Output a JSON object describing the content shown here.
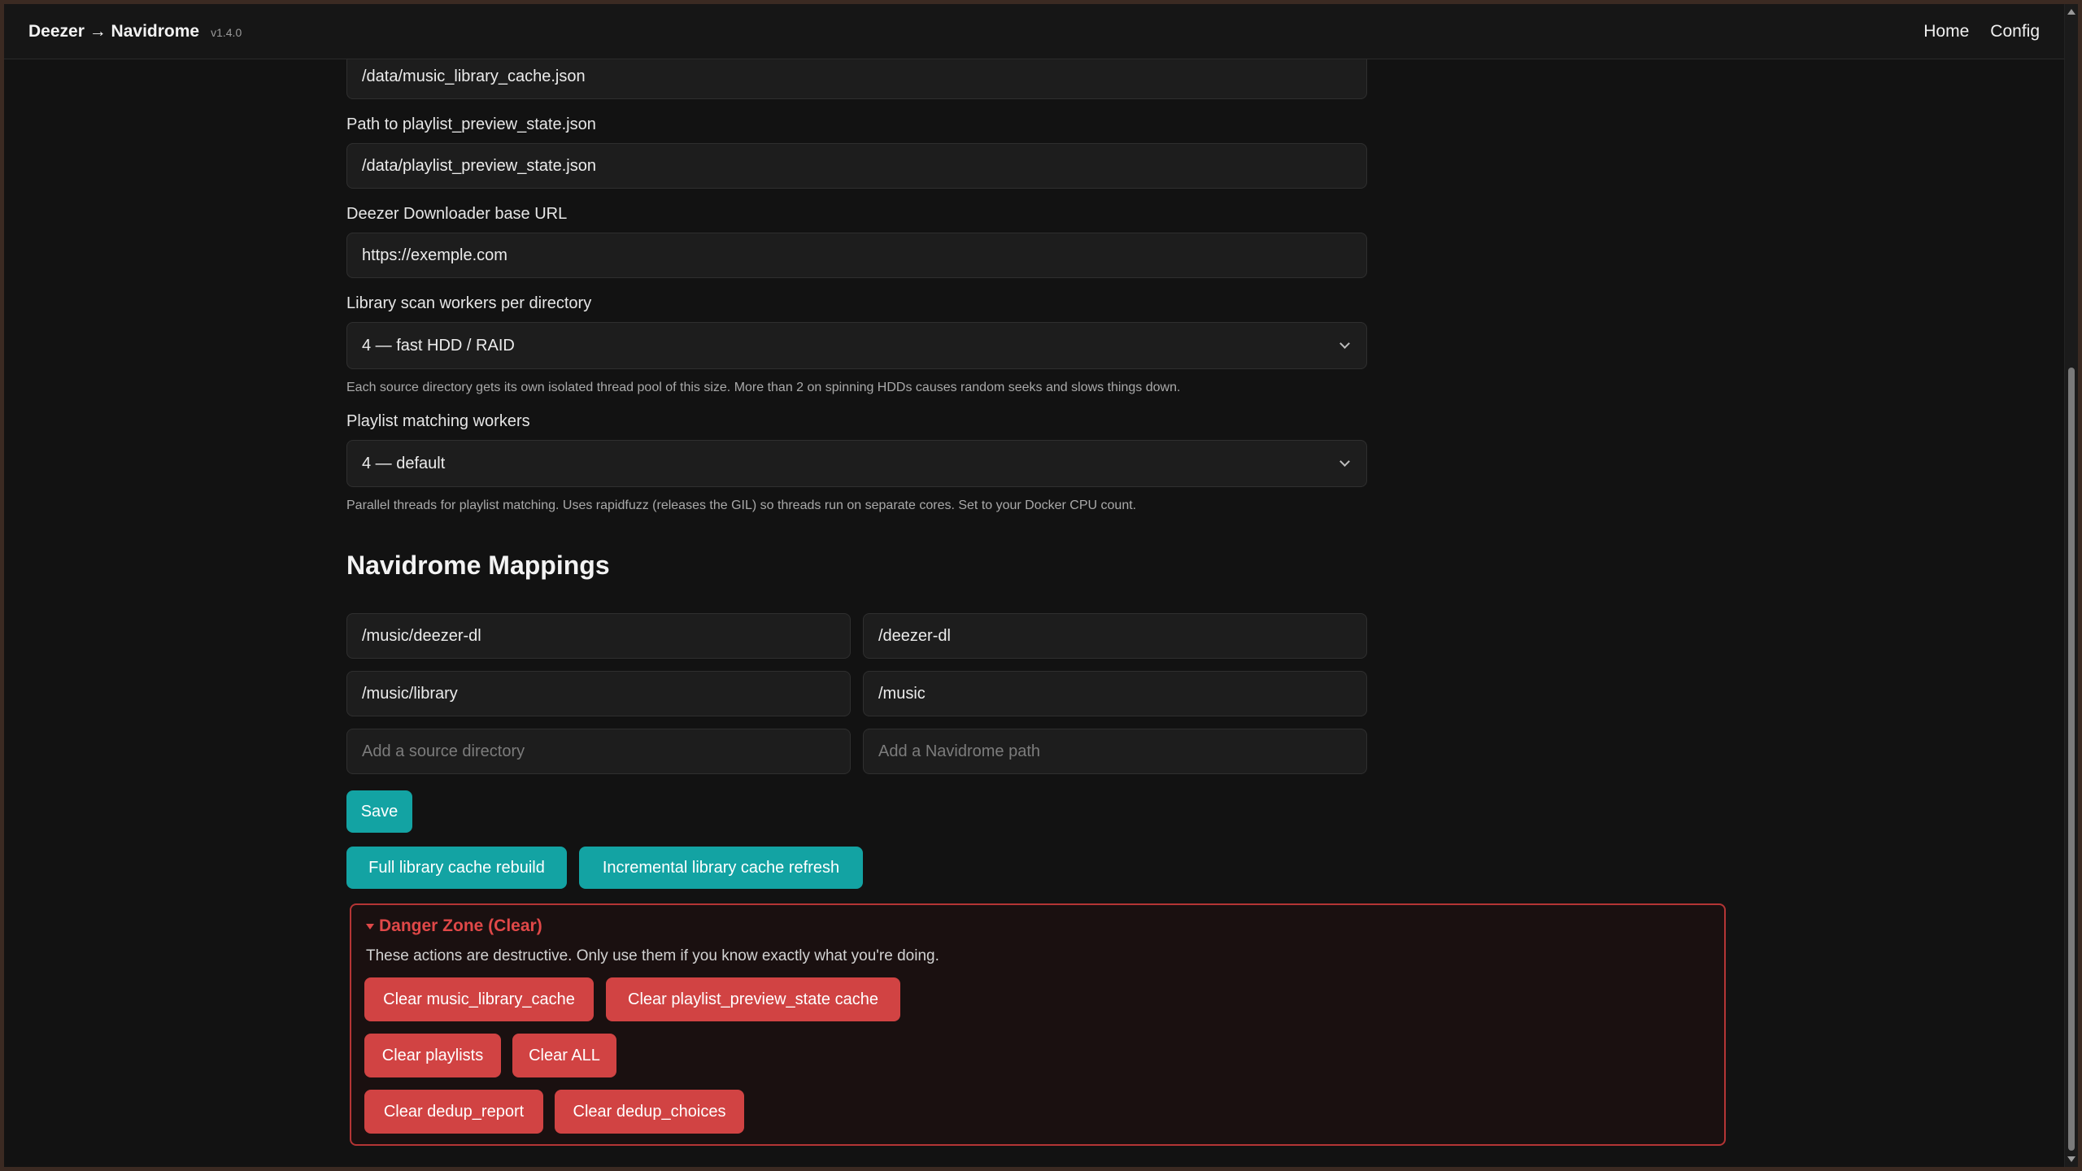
{
  "header": {
    "brand": "Deezer → Navidrome",
    "version": "v1.4.0",
    "nav": [
      "Home",
      "Config"
    ]
  },
  "form": {
    "cache_path_value": "/data/music_library_cache.json",
    "preview_label": "Path to playlist_preview_state.json",
    "preview_value": "/data/playlist_preview_state.json",
    "downloader_label": "Deezer Downloader base URL",
    "downloader_value": "https://exemple.com",
    "scan_label": "Library scan workers per directory",
    "scan_value": "4 — fast HDD / RAID",
    "scan_help": "Each source directory gets its own isolated thread pool of this size. More than 2 on spinning HDDs causes random seeks and slows things down.",
    "match_label": "Playlist matching workers",
    "match_value": "4 — default",
    "match_help": "Parallel threads for playlist matching. Uses rapidfuzz (releases the GIL) so threads run on separate cores. Set to your Docker CPU count."
  },
  "mappings": {
    "title": "Navidrome Mappings",
    "rows": [
      {
        "source": "/music/deezer-dl",
        "target": "/deezer-dl"
      },
      {
        "source": "/music/library",
        "target": "/music"
      }
    ],
    "source_placeholder": "Add a source directory",
    "target_placeholder": "Add a Navidrome path"
  },
  "actions": {
    "save": "Save",
    "full_rebuild": "Full library cache rebuild",
    "incremental": "Incremental library cache refresh"
  },
  "danger": {
    "title": "Danger Zone (Clear)",
    "description": "These actions are destructive. Only use them if you know exactly what you're doing.",
    "clear_music_cache": "Clear music_library_cache",
    "clear_preview_cache": "Clear playlist_preview_state cache",
    "clear_playlists": "Clear playlists",
    "clear_all": "Clear ALL",
    "clear_dedup_report": "Clear dedup_report",
    "clear_dedup_choices": "Clear dedup_choices"
  },
  "colors": {
    "accent": "#13a3a3",
    "danger": "#d14343",
    "background": "#121212"
  }
}
